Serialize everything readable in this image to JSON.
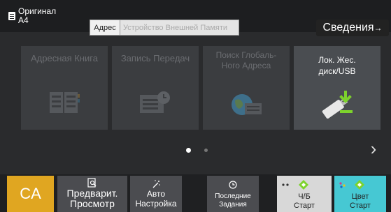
{
  "header": {
    "original_label": "Оригинал",
    "original_size": "A4",
    "address_label": "Адрес",
    "address_placeholder": "Устройство Внешней Памяти",
    "details_label": "Сведения",
    "details_arrow": "→"
  },
  "tiles": [
    {
      "label": "Адресная Книга",
      "icon": "address-book-icon",
      "enabled": false
    },
    {
      "label": "Запись Передач",
      "icon": "transmission-log-icon",
      "enabled": false
    },
    {
      "label": "Поиск Глобаль-\nНого Адреса",
      "label_line1": "Поиск Глобаль-",
      "label_line2": "Ного Адреса",
      "icon": "global-address-icon",
      "enabled": false
    },
    {
      "label": "Лок. Жес.\nдиск/USB",
      "label_line1": "Лок. Жес.",
      "label_line2": "диск/USB",
      "icon": "usb-download-icon",
      "enabled": true
    }
  ],
  "pager": {
    "current": 1,
    "total": 2
  },
  "bottom": {
    "ca_label": "CA",
    "preview_line1": "Предварит.",
    "preview_line2": "Просмотр",
    "auto_line1": "Авто",
    "auto_line2": "Настройка",
    "recent_line1": "Последние",
    "recent_line2": "Задания",
    "bw_line1": "Ч/Б",
    "bw_line2": "Старт",
    "color_line1": "Цвет",
    "color_line2": "Старт"
  },
  "colors": {
    "ca": "#e0a621",
    "color_start": "#46c8d3",
    "bw_start": "#d8d8d8",
    "start_diamond": "#7dd32c"
  }
}
